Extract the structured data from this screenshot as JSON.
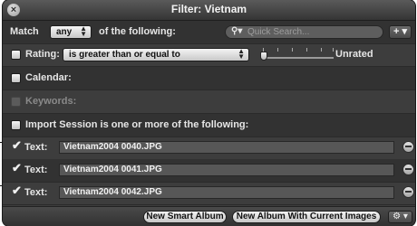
{
  "window": {
    "title": "Filter: Vietnam"
  },
  "match_row": {
    "prefix": "Match",
    "mode_value": "any",
    "suffix": "of the following:",
    "search_placeholder": "Quick Search...",
    "add_icon": "plus-icon"
  },
  "rating_row": {
    "label": "Rating:",
    "checked": false,
    "operator_value": "is greater than or equal to",
    "slider_value": "Unrated"
  },
  "calendar_row": {
    "label": "Calendar:",
    "checked": false
  },
  "keywords_row": {
    "label": "Keywords:",
    "enabled": false
  },
  "import_row": {
    "label": "Import Session is one or more of the following:",
    "checked": false
  },
  "text_rows": [
    {
      "label": "Text:",
      "checked": true,
      "value": "Vietnam2004 0040.JPG"
    },
    {
      "label": "Text:",
      "checked": true,
      "value": "Vietnam2004 0041.JPG"
    },
    {
      "label": "Text:",
      "checked": true,
      "value": "Vietnam2004 0042.JPG"
    }
  ],
  "bottom_bar": {
    "new_smart_album": "New Smart Album",
    "new_album_with_images": "New Album With Current Images",
    "action_icon": "gear-icon"
  }
}
